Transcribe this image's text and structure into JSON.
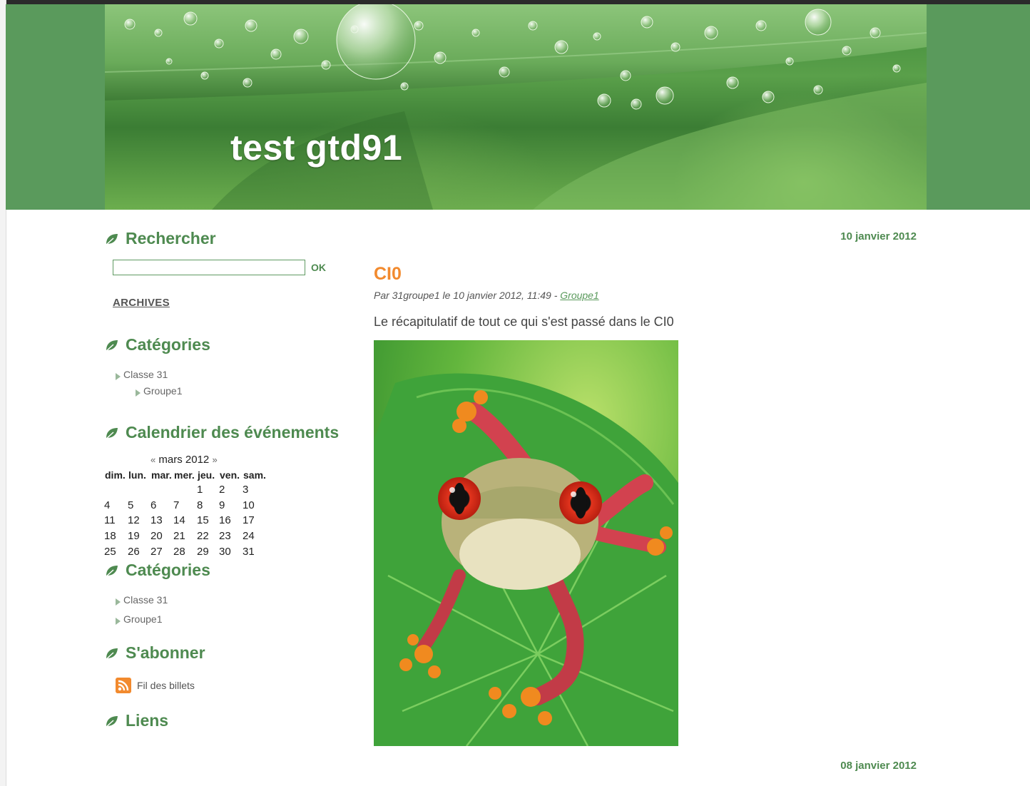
{
  "site": {
    "title": "test gtd91"
  },
  "search": {
    "heading": "Rechercher",
    "placeholder": "",
    "value": "",
    "submit_label": "OK"
  },
  "archives_label": "ARCHIVES",
  "categories_widget": {
    "heading": "Catégories",
    "items": [
      {
        "label": "Classe 31"
      },
      {
        "label": "Groupe1"
      }
    ]
  },
  "calendar": {
    "heading": "Calendrier des événements",
    "prev": "«",
    "month": "mars 2012",
    "next": "»",
    "days": [
      "dim.",
      "lun.",
      "mar.",
      "mer.",
      "jeu.",
      "ven.",
      "sam."
    ],
    "weeks": [
      [
        "",
        "",
        "",
        "",
        "1",
        "2",
        "3"
      ],
      [
        "4",
        "5",
        "6",
        "7",
        "8",
        "9",
        "10"
      ],
      [
        "11",
        "12",
        "13",
        "14",
        "15",
        "16",
        "17"
      ],
      [
        "18",
        "19",
        "20",
        "21",
        "22",
        "23",
        "24"
      ],
      [
        "25",
        "26",
        "27",
        "28",
        "29",
        "30",
        "31"
      ]
    ]
  },
  "categories_widget_2": {
    "heading": "Catégories",
    "items": [
      {
        "label": "Classe 31"
      },
      {
        "label": "Groupe1"
      }
    ]
  },
  "subscribe": {
    "heading": "S'abonner",
    "feed_label": "Fil des billets",
    "icon": "rss-icon"
  },
  "links": {
    "heading": "Liens"
  },
  "posts": [
    {
      "date": "10 janvier 2012",
      "title": "CI0",
      "meta_prefix": "Par 31groupe1 le 10 janvier 2012, 11:49 - ",
      "category": "Groupe1",
      "body": "Le récapitulatif de tout ce qui s'est passé dans le CI0",
      "image_alt": "red-eyed tree frog on a leaf"
    },
    {
      "date": "08 janvier 2012"
    }
  ],
  "colors": {
    "accent": "#4e8a50",
    "post_title": "#f28a2e",
    "header_band": "#5a9a5c"
  }
}
